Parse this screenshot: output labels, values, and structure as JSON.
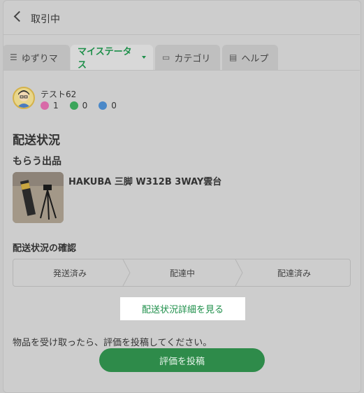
{
  "header": {
    "title": "取引中"
  },
  "tabs": [
    {
      "label": "ゆずりマ",
      "icon": "list-icon"
    },
    {
      "label": "マイステータス",
      "icon": "caret-down-icon"
    },
    {
      "label": "カテゴリ",
      "icon": "folder-icon"
    },
    {
      "label": "ヘルプ",
      "icon": "book-icon"
    }
  ],
  "user": {
    "name": "テスト62",
    "ratings": {
      "good": "1",
      "normal": "0",
      "bad": "0"
    }
  },
  "shipping": {
    "title": "配送状況",
    "product_heading": "もらう出品",
    "product_name": "HAKUBA 三脚 W312B 3WAY雲台",
    "confirm_heading": "配送状況の確認",
    "steps": [
      "発送済み",
      "配達中",
      "配達済み"
    ],
    "detail_link": "配送状況詳細を見る"
  },
  "footer": {
    "notice": "物品を受け取ったら、評価を投稿してください。",
    "submit_label": "評価を投稿"
  },
  "colors": {
    "accent": "#1e8f4a",
    "button": "#2e8b4a"
  }
}
